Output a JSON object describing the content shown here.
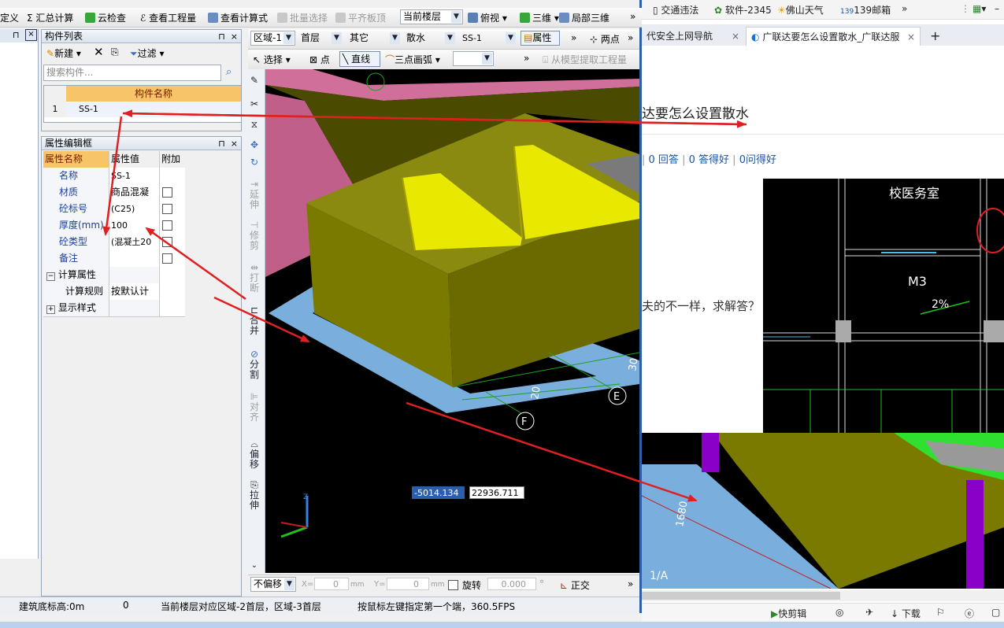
{
  "browser": {
    "bookmarks": [
      {
        "label": "交通违法"
      },
      {
        "label": "软件-2345"
      },
      {
        "label": "佛山天气"
      },
      {
        "label": "139邮箱"
      }
    ],
    "bookmark_more": "»",
    "tabs": [
      {
        "label": "代安全上网导航",
        "close": "×"
      },
      {
        "label": "广联达要怎么设置散水_广联达服",
        "close": "×"
      }
    ],
    "new_tab": "+",
    "article_title": "达要怎么设置散水",
    "stats": [
      {
        "text": "0 回答"
      },
      {
        "text": "0 答得好"
      },
      {
        "text": "0问得好"
      }
    ],
    "question_text": "夫的不一样，求解答？",
    "cad_image": {
      "room_label": "校医务室",
      "door_label": "M3",
      "slope_label": "2%"
    },
    "model_image": {
      "dim_label": "1680",
      "axis_label": "1/A"
    },
    "status": {
      "clip_label": "快剪辑",
      "download_label": "下载"
    }
  },
  "app": {
    "toolbar": {
      "define_label": "定义",
      "sum_calc_label": "汇总计算",
      "cloud_check_label": "云检查",
      "view_quantity_label": "查看工程量",
      "view_formula_label": "查看计算式",
      "batch_select_label": "批量选择",
      "align_top_label": "平齐板顶",
      "floor_select": "当前楼层",
      "view_select": "俯视",
      "three_d_label": "三维",
      "local_3d_label": "局部三维",
      "more": "»"
    },
    "component_list": {
      "title": "构件列表",
      "new_label": "新建",
      "filter_label": "过滤",
      "search_placeholder": "搜索构件...",
      "column_header": "构件名称",
      "rows": [
        {
          "index": "1",
          "name": "SS-1"
        }
      ]
    },
    "property_editor": {
      "title": "属性编辑框",
      "headers": {
        "name": "属性名称",
        "value": "属性值",
        "extra": "附加"
      },
      "rows": [
        {
          "name": "名称",
          "value": "SS-1"
        },
        {
          "name": "材质",
          "value": "商品混凝"
        },
        {
          "name": "砼标号",
          "value": "(C25)"
        },
        {
          "name": "厚度(mm)",
          "value": "100"
        },
        {
          "name": "砼类型",
          "value": "(混凝土20"
        },
        {
          "name": "备注",
          "value": ""
        }
      ],
      "calc_group": {
        "toggle": "−",
        "label": "计算属性",
        "rule_name": "计算规则",
        "rule_value": "按默认计"
      },
      "style_group": {
        "toggle": "+",
        "label": "显示样式"
      }
    },
    "view_toolbar1": {
      "region_select": "区域-1",
      "floor_select": "首层",
      "type_select": "其它",
      "category_select": "散水",
      "component_select": "SS-1",
      "property_label": "属性",
      "two_point_label": "两点",
      "more": "»"
    },
    "view_toolbar2": {
      "select_label": "选择",
      "point_label": "点",
      "line_label": "直线",
      "arc_label": "三点画弧",
      "extract_label": "从模型提取工程量",
      "more": "»"
    },
    "vertical_tools": [
      "延伸",
      "修剪",
      "打断",
      "合并",
      "分割",
      "对齐",
      "偏移",
      "拉伸"
    ],
    "viewport": {
      "axis_labels": [
        "E",
        "F"
      ],
      "dim_labels": [
        "20",
        "30"
      ],
      "coord_x": "-5014.134",
      "coord_y": "22936.711"
    },
    "bottom_toolbar": {
      "offset_select": "不偏移",
      "x_label": "X=",
      "x_value": "0",
      "y_label": "Y=",
      "y_value": "0",
      "unit": "mm",
      "rotate_label": "旋转",
      "rotate_value": "0.000",
      "degree": "°",
      "ortho_label": "正交",
      "more": "»"
    },
    "status_bar": {
      "elevation": "建筑底标高:0m",
      "value": "0",
      "floor_info": "当前楼层对应区域-2首层，区域-3首层",
      "hint": "按鼠标左键指定第一个端，360.5FPS"
    }
  },
  "colors": {
    "annotation_arrow": "#e02020",
    "slab_yellow": "#e8e800",
    "wall_olive": "#7a7a00",
    "slab_pink": "#d0709a",
    "apron_blue": "#7aaedc"
  }
}
